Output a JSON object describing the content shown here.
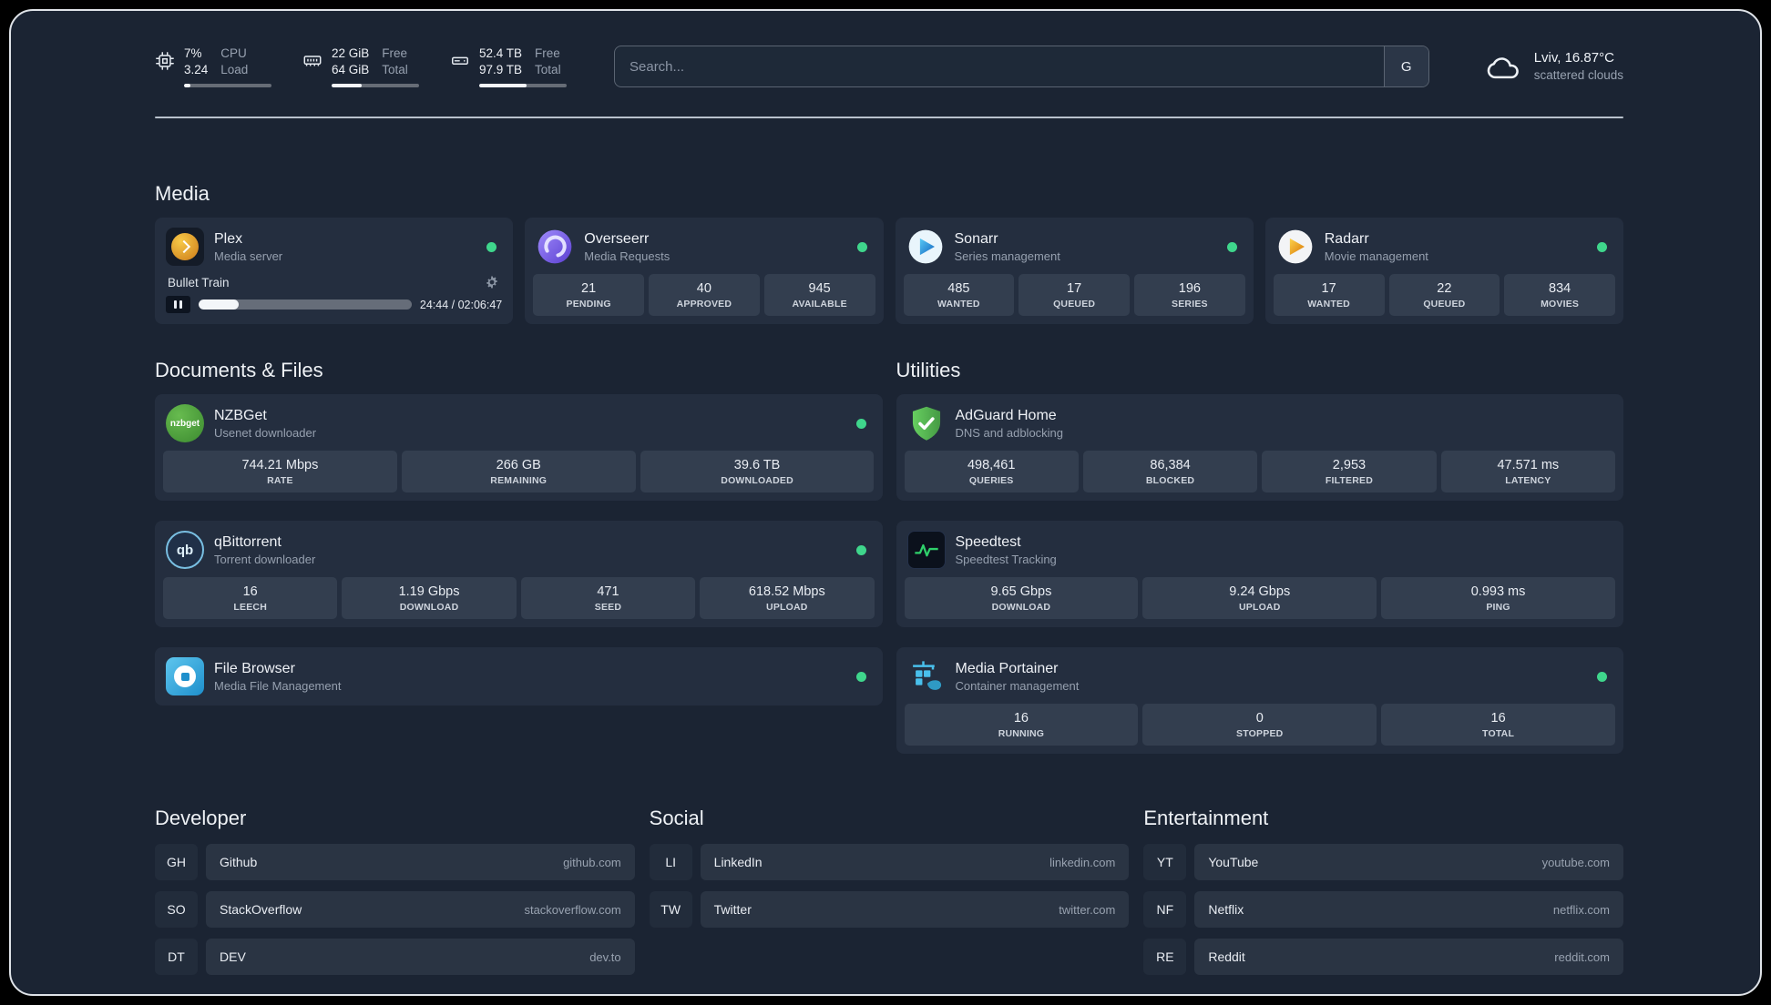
{
  "topbar": {
    "cpu": {
      "value1": "7%",
      "value2": "3.24",
      "label1": "CPU",
      "label2": "Load",
      "bar_pct": 7
    },
    "memory": {
      "value1": "22 GiB",
      "value2": "64 GiB",
      "label1": "Free",
      "label2": "Total",
      "bar_pct": 34
    },
    "disk": {
      "value1": "52.4 TB",
      "value2": "97.9 TB",
      "label1": "Free",
      "label2": "Total",
      "bar_pct": 54
    },
    "search": {
      "placeholder": "Search...",
      "provider_label": "G"
    },
    "weather": {
      "location": "Lviv, 16.87°C",
      "condition": "scattered clouds"
    }
  },
  "section_titles": {
    "media": "Media",
    "documents": "Documents & Files",
    "utilities": "Utilities",
    "developer": "Developer",
    "social": "Social",
    "entertainment": "Entertainment"
  },
  "services": {
    "plex": {
      "name": "Plex",
      "desc": "Media server",
      "now_playing": "Bullet Train",
      "time": "24:44 / 02:06:47",
      "progress_pct": 19
    },
    "overseerr": {
      "name": "Overseerr",
      "desc": "Media Requests",
      "stats": [
        {
          "value": "21",
          "label": "PENDING"
        },
        {
          "value": "40",
          "label": "APPROVED"
        },
        {
          "value": "945",
          "label": "AVAILABLE"
        }
      ]
    },
    "sonarr": {
      "name": "Sonarr",
      "desc": "Series management",
      "stats": [
        {
          "value": "485",
          "label": "WANTED"
        },
        {
          "value": "17",
          "label": "QUEUED"
        },
        {
          "value": "196",
          "label": "SERIES"
        }
      ]
    },
    "radarr": {
      "name": "Radarr",
      "desc": "Movie management",
      "stats": [
        {
          "value": "17",
          "label": "WANTED"
        },
        {
          "value": "22",
          "label": "QUEUED"
        },
        {
          "value": "834",
          "label": "MOVIES"
        }
      ]
    },
    "nzbget": {
      "name": "NZBGet",
      "desc": "Usenet downloader",
      "stats": [
        {
          "value": "744.21 Mbps",
          "label": "RATE"
        },
        {
          "value": "266 GB",
          "label": "REMAINING"
        },
        {
          "value": "39.6 TB",
          "label": "DOWNLOADED"
        }
      ]
    },
    "qbittorrent": {
      "name": "qBittorrent",
      "desc": "Torrent downloader",
      "stats": [
        {
          "value": "16",
          "label": "LEECH"
        },
        {
          "value": "1.19 Gbps",
          "label": "DOWNLOAD"
        },
        {
          "value": "471",
          "label": "SEED"
        },
        {
          "value": "618.52 Mbps",
          "label": "UPLOAD"
        }
      ]
    },
    "filebrowser": {
      "name": "File Browser",
      "desc": "Media File Management"
    },
    "adguard": {
      "name": "AdGuard Home",
      "desc": "DNS and adblocking",
      "stats": [
        {
          "value": "498,461",
          "label": "QUERIES"
        },
        {
          "value": "86,384",
          "label": "BLOCKED"
        },
        {
          "value": "2,953",
          "label": "FILTERED"
        },
        {
          "value": "47.571 ms",
          "label": "LATENCY"
        }
      ]
    },
    "speedtest": {
      "name": "Speedtest",
      "desc": "Speedtest Tracking",
      "stats": [
        {
          "value": "9.65 Gbps",
          "label": "DOWNLOAD"
        },
        {
          "value": "9.24 Gbps",
          "label": "UPLOAD"
        },
        {
          "value": "0.993 ms",
          "label": "PING"
        }
      ]
    },
    "portainer": {
      "name": "Media Portainer",
      "desc": "Container management",
      "stats": [
        {
          "value": "16",
          "label": "RUNNING"
        },
        {
          "value": "0",
          "label": "STOPPED"
        },
        {
          "value": "16",
          "label": "TOTAL"
        }
      ]
    }
  },
  "icon_texts": {
    "nzbget": "nzbget",
    "qbittorrent": "qb"
  },
  "bookmarks": {
    "developer": [
      {
        "abbr": "GH",
        "name": "Github",
        "url": "github.com"
      },
      {
        "abbr": "SO",
        "name": "StackOverflow",
        "url": "stackoverflow.com"
      },
      {
        "abbr": "DT",
        "name": "DEV",
        "url": "dev.to"
      }
    ],
    "social": [
      {
        "abbr": "LI",
        "name": "LinkedIn",
        "url": "linkedin.com"
      },
      {
        "abbr": "TW",
        "name": "Twitter",
        "url": "twitter.com"
      }
    ],
    "entertainment": [
      {
        "abbr": "YT",
        "name": "YouTube",
        "url": "youtube.com"
      },
      {
        "abbr": "NF",
        "name": "Netflix",
        "url": "netflix.com"
      },
      {
        "abbr": "RE",
        "name": "Reddit",
        "url": "reddit.com"
      }
    ]
  },
  "colors": {
    "status_green": "#3fd68c",
    "background": "#1b2433"
  }
}
